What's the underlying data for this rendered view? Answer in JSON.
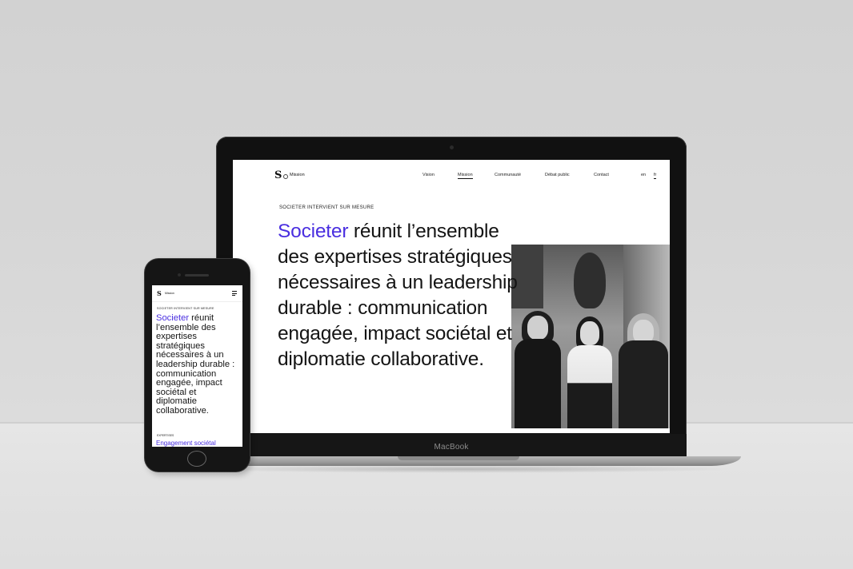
{
  "scene": {
    "device_brand": "MacBook"
  },
  "desktop_site": {
    "logo": "S",
    "nav_brand": "Mission",
    "nav_items": [
      "Vision",
      "Mission",
      "Communauté",
      "Débat public",
      "Contact"
    ],
    "active_nav": "Mission",
    "languages": [
      "en",
      "fr"
    ],
    "eyebrow": "SOCIETER INTERVIENT SUR MESURE",
    "headline_accent": "Societer",
    "headline_lines": [
      "réunit l’ensemble",
      "des expertises stratégiques",
      "nécessaires à un leadership",
      "durable : communication",
      "engagée, impact sociétal et",
      "diplomatie collaborative."
    ]
  },
  "mobile_site": {
    "logo": "S",
    "nav_brand": "Mission",
    "eyebrow": "SOCIETER INTERVIENT SUR MESURE",
    "headline_accent": "Societer",
    "headline_rest": "réunit l’ensemble des expertises stratégiques nécessaires à un leadership durable : communication engagée, impact sociétal et diplomatie collaborative.",
    "section_label": "EXPERTISES",
    "section_link": "Engagement sociétal"
  },
  "colors": {
    "accent": "#4a2fe0",
    "text": "#141414"
  }
}
